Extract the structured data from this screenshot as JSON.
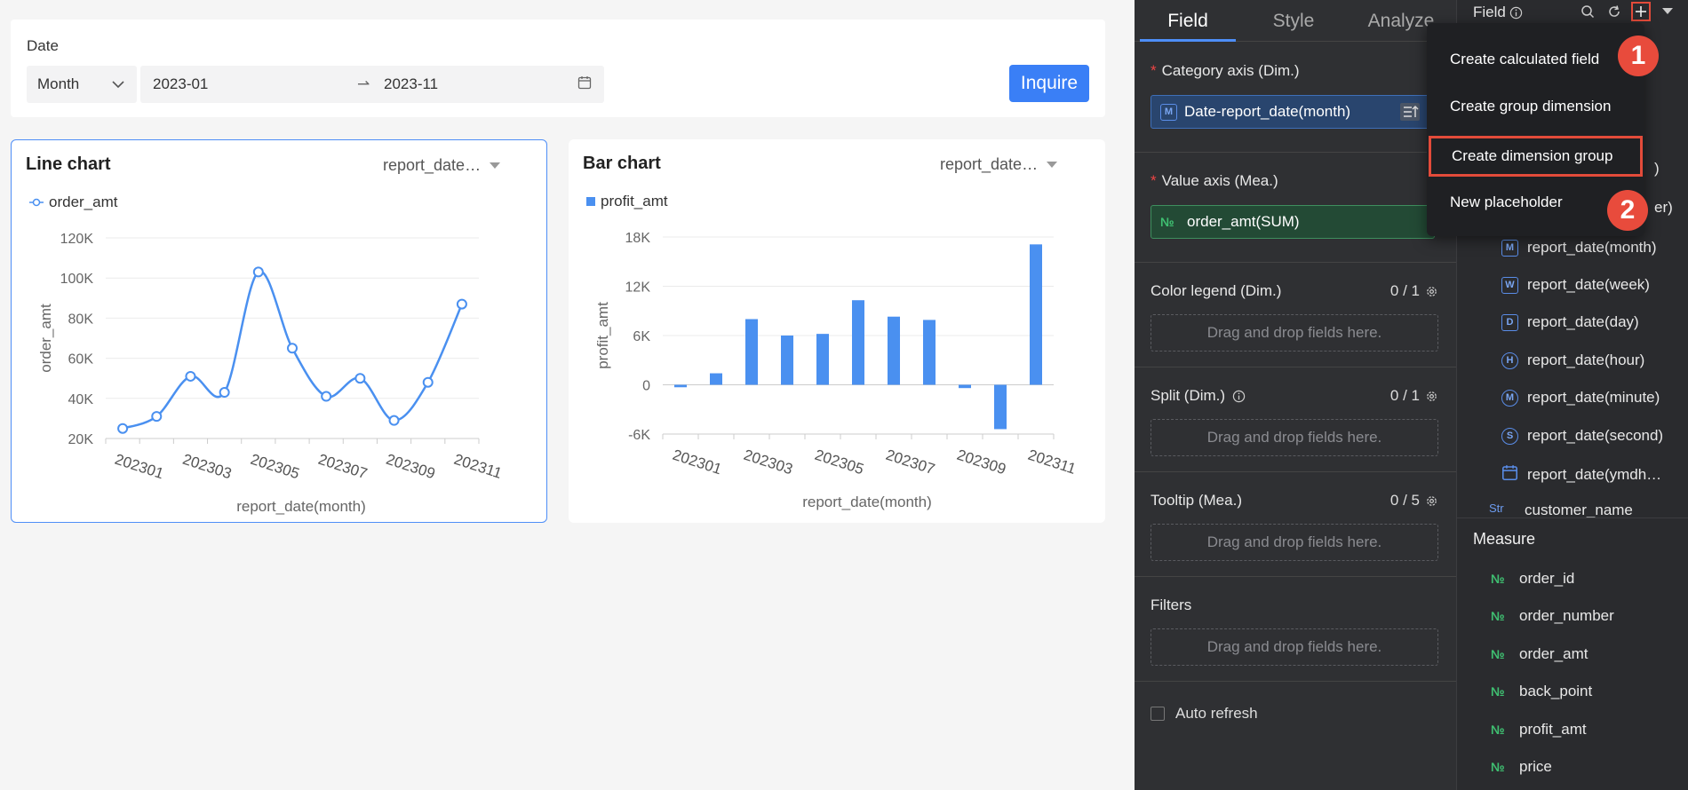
{
  "filter": {
    "label": "Date",
    "granularity": "Month",
    "start": "2023-01",
    "end": "2023-11",
    "range_arrow": "⇀",
    "inquire_label": "Inquire"
  },
  "line_card": {
    "title": "Line chart",
    "dropdown": "report_date…",
    "legend": "order_amt"
  },
  "bar_card": {
    "title": "Bar chart",
    "dropdown": "report_date…",
    "legend": "profit_amt"
  },
  "chart_data": [
    {
      "type": "line",
      "title": "Line chart",
      "x": [
        "202301",
        "202302",
        "202303",
        "202304",
        "202305",
        "202306",
        "202307",
        "202308",
        "202309",
        "202310",
        "202311"
      ],
      "x_tick_labels": [
        "202301",
        "202303",
        "202305",
        "202307",
        "202309",
        "202311"
      ],
      "series": [
        {
          "name": "order_amt",
          "values": [
            25000,
            31000,
            51000,
            43000,
            103000,
            65000,
            41000,
            50000,
            29000,
            48000,
            87000
          ]
        }
      ],
      "xlabel": "report_date(month)",
      "ylabel": "order_amt",
      "y_ticks": [
        20000,
        40000,
        60000,
        80000,
        100000,
        120000
      ],
      "y_tick_labels": [
        "20K",
        "40K",
        "60K",
        "80K",
        "100K",
        "120K"
      ],
      "ylim": [
        20000,
        120000
      ],
      "smooth": true,
      "legend": "top-left",
      "color": "#4a90f0"
    },
    {
      "type": "bar",
      "title": "Bar chart",
      "categories": [
        "202301",
        "202302",
        "202303",
        "202304",
        "202305",
        "202306",
        "202307",
        "202308",
        "202309",
        "202310",
        "202311"
      ],
      "x_tick_labels": [
        "202301",
        "202303",
        "202305",
        "202307",
        "202309",
        "202311"
      ],
      "series": [
        {
          "name": "profit_amt",
          "values": [
            -300,
            1400,
            8000,
            6000,
            6200,
            10300,
            8300,
            7900,
            -400,
            -5400,
            17100
          ]
        }
      ],
      "xlabel": "report_date(month)",
      "ylabel": "profit_amt",
      "y_ticks": [
        -6000,
        0,
        6000,
        12000,
        18000
      ],
      "y_tick_labels": [
        "-6K",
        "0",
        "6K",
        "12K",
        "18K"
      ],
      "ylim": [
        -6000,
        18000
      ],
      "legend": "top-left",
      "color": "#4a90f0"
    }
  ],
  "config": {
    "tabs": [
      {
        "label": "Field"
      },
      {
        "label": "Style"
      },
      {
        "label": "Analyze"
      }
    ],
    "category_axis": {
      "label": "Category axis (Dim.)",
      "field": "Date-report_date(month)",
      "icon": "M"
    },
    "value_axis": {
      "label": "Value axis (Mea.)",
      "field": "order_amt(SUM)",
      "icon": "№"
    },
    "color_legend": {
      "label": "Color legend (Dim.)",
      "count": "0 / 1",
      "placeholder": "Drag and drop fields here."
    },
    "split": {
      "label": "Split (Dim.)",
      "count": "0 / 1",
      "placeholder": "Drag and drop fields here."
    },
    "tooltip": {
      "label": "Tooltip (Mea.)",
      "count": "0 / 5",
      "placeholder": "Drag and drop fields here."
    },
    "filters": {
      "label": "Filters",
      "placeholder": "Drag and drop fields here."
    },
    "auto_refresh": "Auto refresh",
    "required_mark": "*"
  },
  "fields_panel": {
    "title": "Field",
    "dimension_items": [
      {
        "icon": "M",
        "label": "report_date(month)"
      },
      {
        "icon": "W",
        "label": "report_date(week)"
      },
      {
        "icon": "D",
        "label": "report_date(day)"
      },
      {
        "icon": "H",
        "label": "report_date(hour)"
      },
      {
        "icon": "M",
        "label": "report_date(minute)"
      },
      {
        "icon": "S",
        "label": "report_date(second)"
      },
      {
        "icon": "cal",
        "label": "report_date(ymdh…"
      }
    ],
    "partial_items": [
      ")",
      "er)"
    ],
    "customer_item": {
      "icon": "Str",
      "label": "customer_name"
    },
    "measure_title": "Measure",
    "measure_items": [
      {
        "icon": "№",
        "label": "order_id"
      },
      {
        "icon": "№",
        "label": "order_number"
      },
      {
        "icon": "№",
        "label": "order_amt"
      },
      {
        "icon": "№",
        "label": "back_point"
      },
      {
        "icon": "№",
        "label": "profit_amt"
      },
      {
        "icon": "№",
        "label": "price"
      }
    ]
  },
  "menu": {
    "items": [
      {
        "label": "Create calculated field"
      },
      {
        "label": "Create group dimension"
      },
      {
        "label": "Create dimension group"
      },
      {
        "label": "New placeholder"
      }
    ]
  },
  "steps": [
    "1",
    "2"
  ],
  "colors": {
    "accent": "#3a7ff6",
    "highlight": "#e34b3a",
    "measure": "#3fbf71",
    "panel": "#2f3033"
  }
}
